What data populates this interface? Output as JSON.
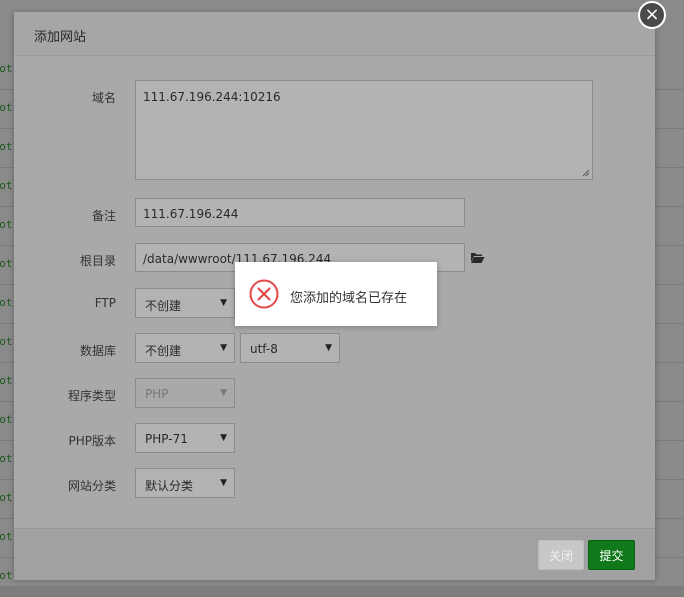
{
  "background": {
    "row_text": "root",
    "row_count": 14
  },
  "dialog": {
    "title": "添加网站",
    "close_symbol": "×"
  },
  "form": {
    "domain": {
      "label": "域名",
      "value": "111.67.196.244:10216"
    },
    "remark": {
      "label": "备注",
      "value": "111.67.196.244"
    },
    "root_dir": {
      "label": "根目录",
      "value": "/data/wwwroot/111.67.196.244",
      "icon": "folder-open-icon"
    },
    "ftp": {
      "label": "FTP",
      "value": "不创建"
    },
    "database": {
      "label": "数据库",
      "value": "不创建",
      "charset": "utf-8"
    },
    "program_type": {
      "label": "程序类型",
      "value": "PHP"
    },
    "php_version": {
      "label": "PHP版本",
      "value": "PHP-71"
    },
    "site_category": {
      "label": "网站分类",
      "value": "默认分类"
    }
  },
  "footer": {
    "close_label": "关闭",
    "submit_label": "提交"
  },
  "toast": {
    "icon": "error-circle-icon",
    "message": "您添加的域名已存在",
    "color": "#e04a4a"
  }
}
